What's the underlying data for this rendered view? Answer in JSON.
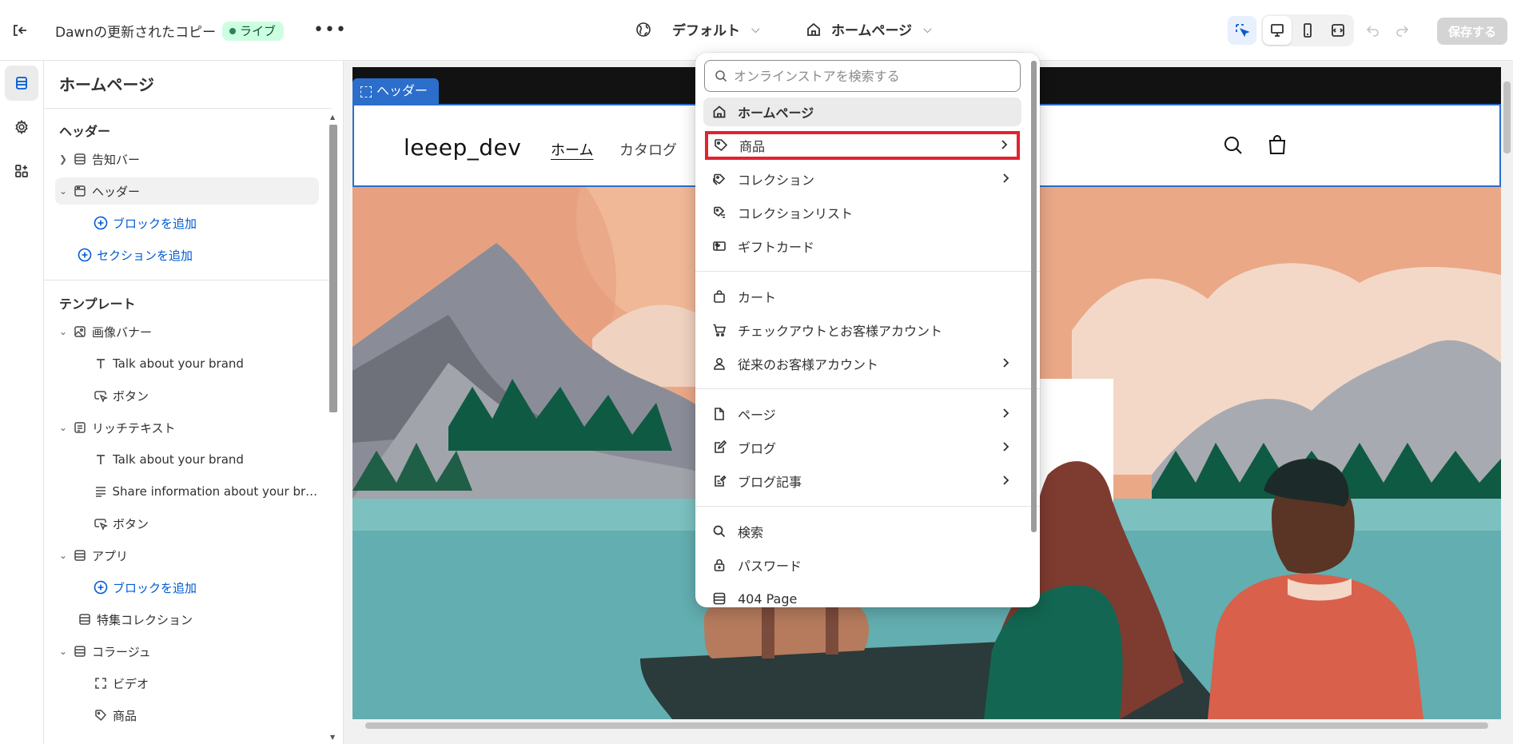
{
  "topbar": {
    "theme_name": "Dawnの更新されたコピー",
    "status_badge": "ライブ",
    "more_label": "•••",
    "locale_label": "デフォルト",
    "page_label": "ホームページ",
    "save_label": "保存する"
  },
  "sidebar": {
    "title": "ホームページ",
    "header_group": {
      "heading": "ヘッダー",
      "items": [
        {
          "label": "告知バー",
          "icon": "section-icon"
        },
        {
          "label": "ヘッダー",
          "icon": "header-section-icon"
        },
        {
          "label": "ブロックを追加",
          "icon": "add-circle-icon"
        },
        {
          "label": "セクションを追加",
          "icon": "add-circle-icon"
        }
      ]
    },
    "template_group": {
      "heading": "テンプレート",
      "items": [
        {
          "label": "画像バナー",
          "icon": "image-icon"
        },
        {
          "label": "Talk about your brand",
          "icon": "text-icon"
        },
        {
          "label": "ボタン",
          "icon": "button-icon"
        },
        {
          "label": "リッチテキスト",
          "icon": "rich-text-icon"
        },
        {
          "label": "Talk about your brand",
          "icon": "text-icon"
        },
        {
          "label": "Share information about your bra...",
          "icon": "paragraph-icon"
        },
        {
          "label": "ボタン",
          "icon": "button-icon"
        },
        {
          "label": "アプリ",
          "icon": "section-icon"
        },
        {
          "label": "ブロックを追加",
          "icon": "add-circle-icon"
        },
        {
          "label": "特集コレクション",
          "icon": "section-icon"
        },
        {
          "label": "コラージュ",
          "icon": "section-icon"
        },
        {
          "label": "ビデオ",
          "icon": "video-icon"
        },
        {
          "label": "商品",
          "icon": "tag-icon"
        }
      ]
    }
  },
  "preview": {
    "section_tag": "ヘッダー",
    "store_logo": "leeep_dev",
    "nav": [
      "ホーム",
      "カタログ"
    ]
  },
  "dropdown": {
    "search_placeholder": "オンラインストアを検索する",
    "items": [
      {
        "label": "ホームページ",
        "icon": "home-icon",
        "selected": true
      },
      {
        "label": "商品",
        "icon": "tag-icon",
        "has_submenu": true,
        "highlighted": true
      },
      {
        "label": "コレクション",
        "icon": "collection-icon",
        "has_submenu": true
      },
      {
        "label": "コレクションリスト",
        "icon": "collection-list-icon"
      },
      {
        "label": "ギフトカード",
        "icon": "gift-card-icon"
      },
      {
        "label": "カート",
        "icon": "bag-icon"
      },
      {
        "label": "チェックアウトとお客様アカウント",
        "icon": "cart-icon"
      },
      {
        "label": "従来のお客様アカウント",
        "icon": "person-icon",
        "has_submenu": true
      },
      {
        "label": "ページ",
        "icon": "page-icon",
        "has_submenu": true
      },
      {
        "label": "ブログ",
        "icon": "blog-icon",
        "has_submenu": true
      },
      {
        "label": "ブログ記事",
        "icon": "blog-post-icon",
        "has_submenu": true
      },
      {
        "label": "検索",
        "icon": "search-icon"
      },
      {
        "label": "パスワード",
        "icon": "lock-icon"
      },
      {
        "label": "404 Page",
        "icon": "section-icon"
      }
    ]
  },
  "colors": {
    "accent_blue": "#005bd3",
    "selection_blue": "#2c6ecb",
    "highlight_red": "#e32230",
    "live_green": "#cdfee1"
  }
}
